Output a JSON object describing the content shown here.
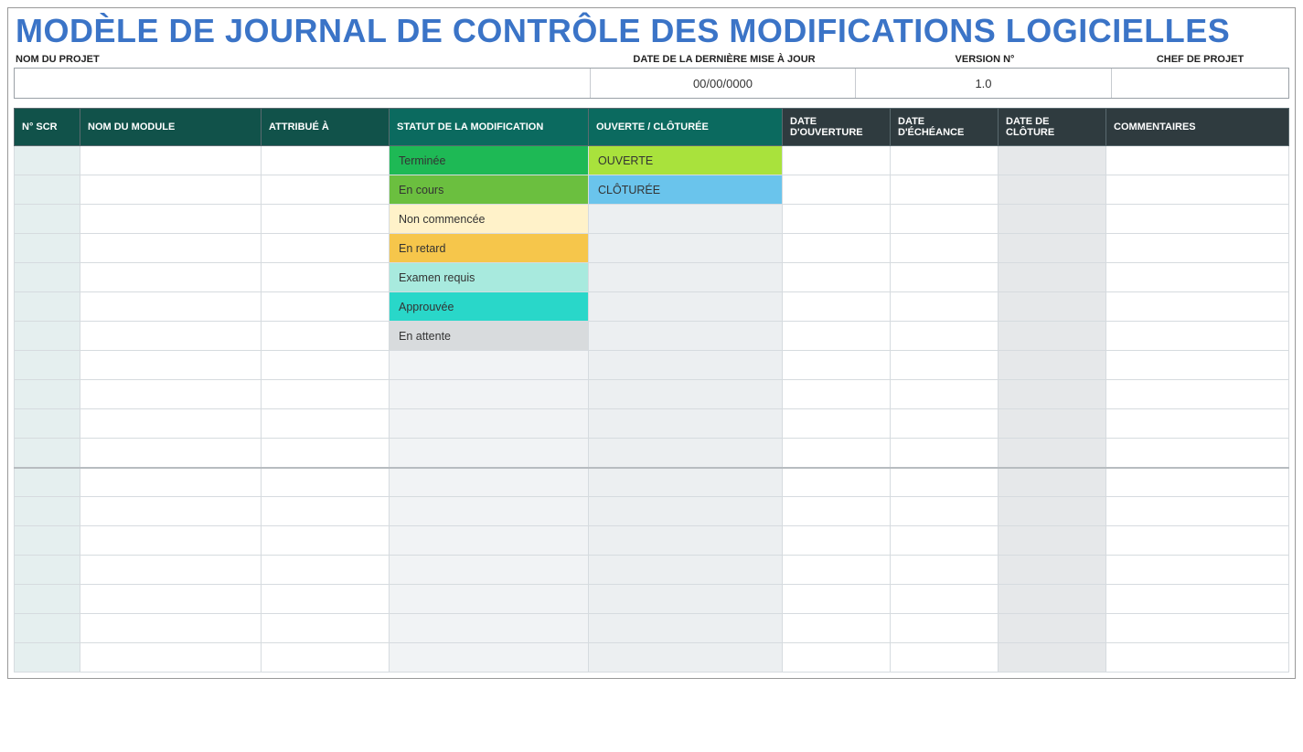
{
  "title": "MODÈLE DE JOURNAL DE CONTRÔLE DES MODIFICATIONS LOGICIELLES",
  "meta_labels": {
    "project_name": "NOM DU PROJET",
    "last_update": "DATE DE LA DERNIÈRE MISE À JOUR",
    "version": "VERSION N°",
    "project_manager": "CHEF DE PROJET"
  },
  "meta_values": {
    "project_name": "",
    "last_update": "00/00/0000",
    "version": "1.0",
    "project_manager": ""
  },
  "columns": {
    "scr": "N° SCR",
    "module": "NOM DU MODULE",
    "assigned": "ATTRIBUÉ À",
    "status": "STATUT DE LA MODIFICATION",
    "openclosed": "OUVERTE / CLÔTURÉE",
    "date_open": "DATE D'OUVERTURE",
    "date_due": "DATE D'ÉCHÉANCE",
    "date_close": "DATE DE CLÔTURE",
    "comments": "COMMENTAIRES"
  },
  "status_styles": {
    "Terminée": "st-done",
    "En cours": "st-inprogress",
    "Non commencée": "st-notstarted",
    "En retard": "st-late",
    "Examen requis": "st-review",
    "Approuvée": "st-approved",
    "En attente": "st-hold"
  },
  "openclosed_styles": {
    "OUVERTE": "oc-open",
    "CLÔTURÉE": "oc-closed"
  },
  "rows": [
    {
      "scr": "",
      "module": "",
      "assigned": "",
      "status": "Terminée",
      "openclosed": "OUVERTE",
      "date_open": "",
      "date_due": "",
      "date_close": "",
      "comments": ""
    },
    {
      "scr": "",
      "module": "",
      "assigned": "",
      "status": "En cours",
      "openclosed": "CLÔTURÉE",
      "date_open": "",
      "date_due": "",
      "date_close": "",
      "comments": ""
    },
    {
      "scr": "",
      "module": "",
      "assigned": "",
      "status": "Non commencée",
      "openclosed": "",
      "date_open": "",
      "date_due": "",
      "date_close": "",
      "comments": ""
    },
    {
      "scr": "",
      "module": "",
      "assigned": "",
      "status": "En retard",
      "openclosed": "",
      "date_open": "",
      "date_due": "",
      "date_close": "",
      "comments": ""
    },
    {
      "scr": "",
      "module": "",
      "assigned": "",
      "status": "Examen requis",
      "openclosed": "",
      "date_open": "",
      "date_due": "",
      "date_close": "",
      "comments": ""
    },
    {
      "scr": "",
      "module": "",
      "assigned": "",
      "status": "Approuvée",
      "openclosed": "",
      "date_open": "",
      "date_due": "",
      "date_close": "",
      "comments": ""
    },
    {
      "scr": "",
      "module": "",
      "assigned": "",
      "status": "En attente",
      "openclosed": "",
      "date_open": "",
      "date_due": "",
      "date_close": "",
      "comments": ""
    },
    {
      "scr": "",
      "module": "",
      "assigned": "",
      "status": "",
      "openclosed": "",
      "date_open": "",
      "date_due": "",
      "date_close": "",
      "comments": ""
    },
    {
      "scr": "",
      "module": "",
      "assigned": "",
      "status": "",
      "openclosed": "",
      "date_open": "",
      "date_due": "",
      "date_close": "",
      "comments": ""
    },
    {
      "scr": "",
      "module": "",
      "assigned": "",
      "status": "",
      "openclosed": "",
      "date_open": "",
      "date_due": "",
      "date_close": "",
      "comments": ""
    },
    {
      "scr": "",
      "module": "",
      "assigned": "",
      "status": "",
      "openclosed": "",
      "date_open": "",
      "date_due": "",
      "date_close": "",
      "comments": ""
    },
    {
      "scr": "",
      "module": "",
      "assigned": "",
      "status": "",
      "openclosed": "",
      "date_open": "",
      "date_due": "",
      "date_close": "",
      "comments": "",
      "heavy": true
    },
    {
      "scr": "",
      "module": "",
      "assigned": "",
      "status": "",
      "openclosed": "",
      "date_open": "",
      "date_due": "",
      "date_close": "",
      "comments": ""
    },
    {
      "scr": "",
      "module": "",
      "assigned": "",
      "status": "",
      "openclosed": "",
      "date_open": "",
      "date_due": "",
      "date_close": "",
      "comments": ""
    },
    {
      "scr": "",
      "module": "",
      "assigned": "",
      "status": "",
      "openclosed": "",
      "date_open": "",
      "date_due": "",
      "date_close": "",
      "comments": ""
    },
    {
      "scr": "",
      "module": "",
      "assigned": "",
      "status": "",
      "openclosed": "",
      "date_open": "",
      "date_due": "",
      "date_close": "",
      "comments": ""
    },
    {
      "scr": "",
      "module": "",
      "assigned": "",
      "status": "",
      "openclosed": "",
      "date_open": "",
      "date_due": "",
      "date_close": "",
      "comments": ""
    },
    {
      "scr": "",
      "module": "",
      "assigned": "",
      "status": "",
      "openclosed": "",
      "date_open": "",
      "date_due": "",
      "date_close": "",
      "comments": ""
    }
  ]
}
